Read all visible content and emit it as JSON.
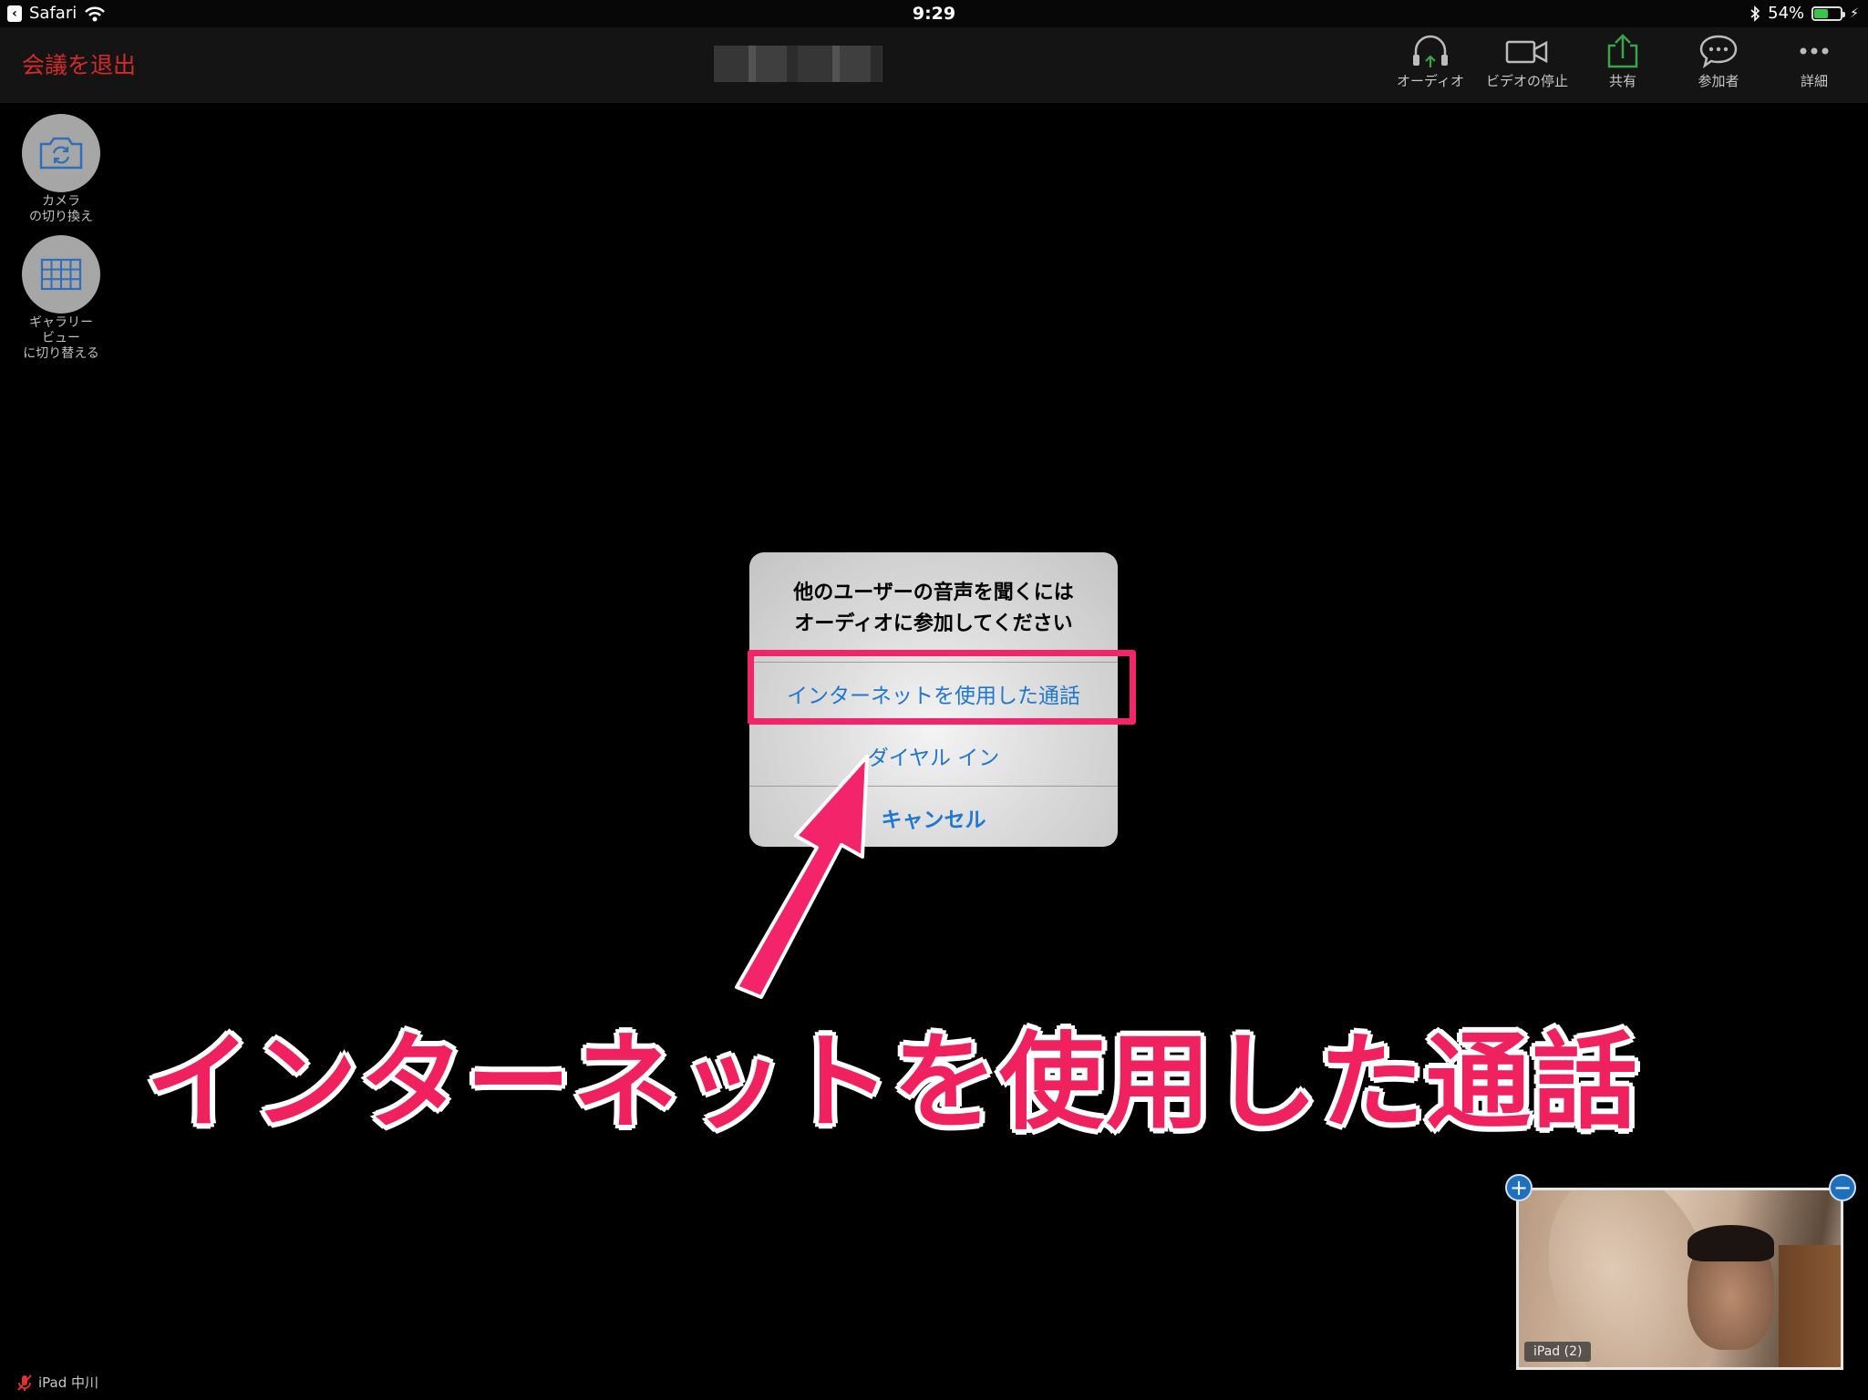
{
  "status_bar": {
    "back_app": "Safari",
    "time": "9:29",
    "battery_percent": "54%",
    "battery_level": 0.54
  },
  "toolbar": {
    "leave_label": "会議を退出",
    "buttons": [
      {
        "label": "オーディオ",
        "icon": "headphones-icon"
      },
      {
        "label": "ビデオの停止",
        "icon": "video-camera-icon"
      },
      {
        "label": "共有",
        "icon": "share-icon"
      },
      {
        "label": "参加者",
        "icon": "chat-bubble-icon"
      },
      {
        "label": "詳細",
        "icon": "more-dots-icon"
      }
    ]
  },
  "side_buttons": {
    "switch_camera": "カメラ\nの切り換え",
    "gallery_view": "ギャラリー\nビュー\nに切り替える"
  },
  "dialog": {
    "message_line1": "他のユーザーの音声を聞くには",
    "message_line2": "オーディオに参加してください",
    "option_internet": "インターネットを使用した通話",
    "option_dial_in": "ダイヤル イン",
    "option_cancel": "キャンセル"
  },
  "annotation": {
    "caption": "インターネットを使用した通話",
    "color": "#f0215f"
  },
  "self_view": {
    "tag": "iPad (2)"
  },
  "self_label": "iPad 中川",
  "colors": {
    "leave": "#d42a2a",
    "link_blue": "#1f77d0",
    "share_green": "#3aa44a"
  }
}
